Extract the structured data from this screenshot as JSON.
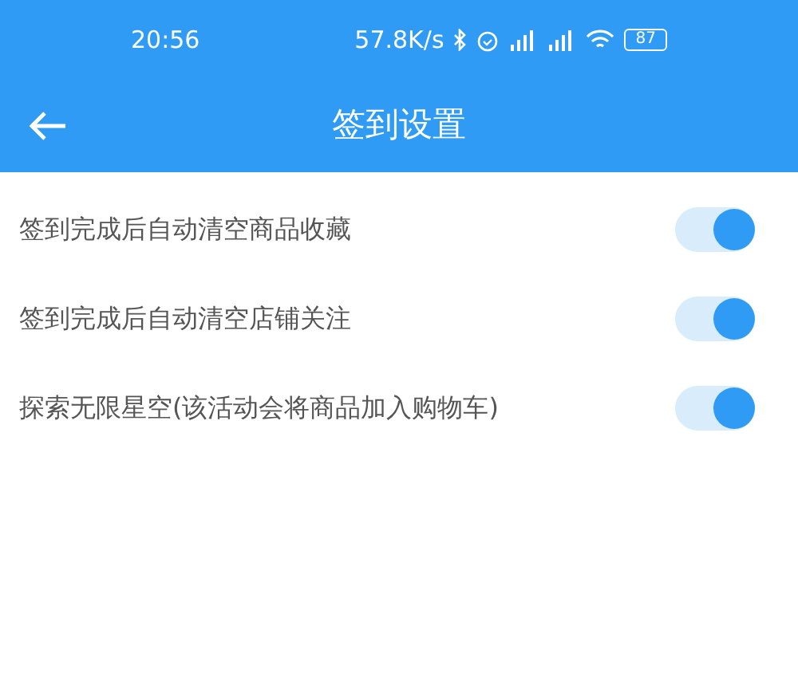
{
  "status_bar": {
    "time": "20:56",
    "speed": "57.8K/s",
    "battery": "87"
  },
  "header": {
    "title": "签到设置"
  },
  "settings": [
    {
      "label": "签到完成后自动清空商品收藏",
      "on": true
    },
    {
      "label": "签到完成后自动清空店铺关注",
      "on": true
    },
    {
      "label": "探索无限星空(该活动会将商品加入购物车)",
      "on": true
    }
  ]
}
